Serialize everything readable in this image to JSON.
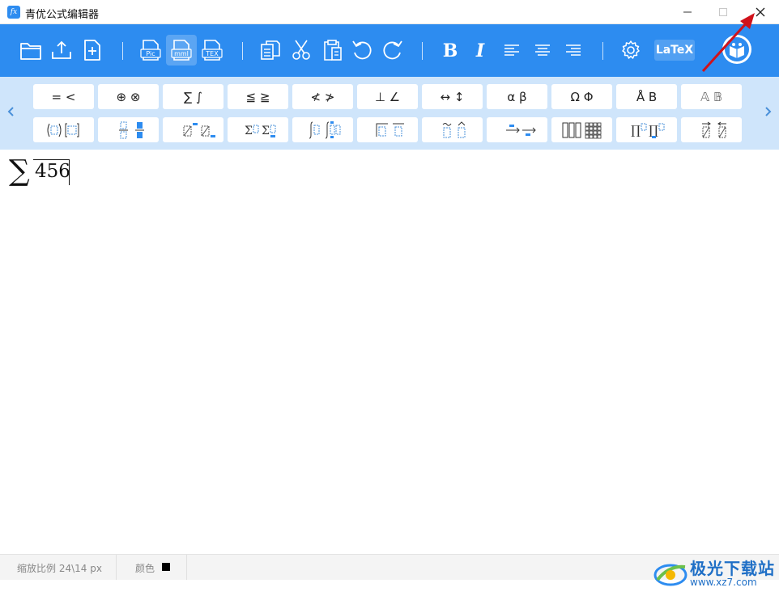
{
  "window": {
    "title": "青优公式编辑器",
    "icon_text": "fx"
  },
  "toolbar": {
    "latex_label": "LaTeX",
    "pic_label": "Pic",
    "mml_label": "mml",
    "tex_label": "TEX",
    "bold_label": "B",
    "italic_label": "I"
  },
  "palette": {
    "row1": [
      "= <",
      "⊕ ⊗",
      "∑ ∫",
      "≦ ≧",
      "≮ ≯",
      "⊥ ∠",
      "↔ ↕",
      "α β",
      "Ω Φ",
      "Å B",
      "𝔸 𝔹"
    ],
    "row2_names": [
      "fence-template",
      "fraction-template",
      "script-template",
      "sum-template",
      "integral-template",
      "bar-template",
      "accent-template",
      "arrow-template",
      "matrix-template",
      "product-template",
      "vector-template"
    ]
  },
  "editor": {
    "sigma": "∑",
    "number": "456"
  },
  "status": {
    "zoom": "缩放比例 24\\14 px",
    "color_label": "颜色",
    "current_color": "#000000"
  },
  "watermark": {
    "line1": "极光下载站",
    "line2": "www.xz7.com"
  },
  "colors": {
    "accent": "#2d8cf0",
    "palette_bg": "#cfe5fb",
    "annotation_arrow": "#d0121b"
  }
}
